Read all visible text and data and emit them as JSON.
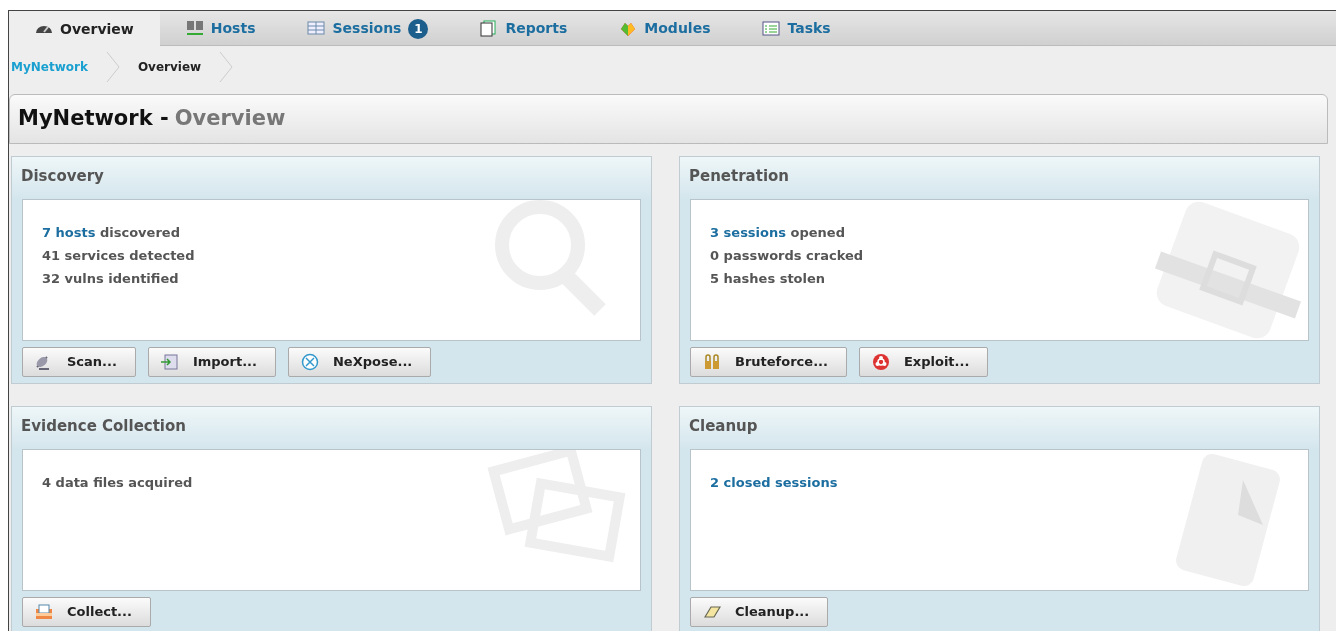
{
  "tabs": [
    {
      "label": "Overview",
      "kind": "gauge",
      "selected": true
    },
    {
      "label": "Hosts",
      "kind": "hosts",
      "selected": false
    },
    {
      "label": "Sessions",
      "kind": "table",
      "selected": false,
      "badge": "1"
    },
    {
      "label": "Reports",
      "kind": "pages",
      "selected": false
    },
    {
      "label": "Modules",
      "kind": "blocks",
      "selected": false
    },
    {
      "label": "Tasks",
      "kind": "list",
      "selected": false
    }
  ],
  "breadcrumb": [
    {
      "label": "MyNetwork",
      "link": true
    },
    {
      "label": "Overview",
      "link": false
    }
  ],
  "page_title": {
    "project": "MyNetwork -",
    "section": "Overview"
  },
  "panels": [
    {
      "title": "Discovery",
      "kind": "magnifier",
      "lines": [
        {
          "link": "7 hosts",
          "text": "discovered"
        },
        {
          "text": "41 services detected"
        },
        {
          "text": "32 vulns identified"
        }
      ],
      "buttons": [
        {
          "label": "Scan...",
          "kind": "dish"
        },
        {
          "label": "Import...",
          "kind": "import"
        },
        {
          "label": "NeXpose...",
          "kind": "cross"
        }
      ]
    },
    {
      "title": "Penetration",
      "kind": "belt",
      "lines": [
        {
          "link": "3 sessions",
          "text": "opened"
        },
        {
          "text": "0 passwords cracked"
        },
        {
          "text": "5 hashes stolen"
        }
      ],
      "buttons": [
        {
          "label": "Bruteforce...",
          "kind": "locks"
        },
        {
          "label": "Exploit...",
          "kind": "biohazard"
        }
      ]
    },
    {
      "title": "Evidence Collection",
      "kind": "photos",
      "lines": [
        {
          "text": "4 data files acquired"
        }
      ],
      "buttons": [
        {
          "label": "Collect...",
          "kind": "tray"
        }
      ]
    },
    {
      "title": "Cleanup",
      "kind": "paper",
      "lines": [
        {
          "link": "2 closed sessions"
        }
      ],
      "buttons": [
        {
          "label": "Cleanup...",
          "kind": "eraser"
        }
      ]
    }
  ]
}
